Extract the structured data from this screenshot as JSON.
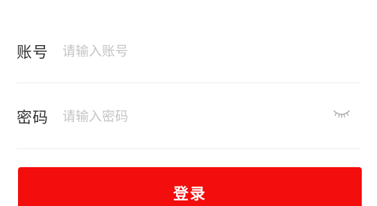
{
  "form": {
    "account": {
      "label": "账号",
      "placeholder": "请输入账号",
      "value": ""
    },
    "password": {
      "label": "密码",
      "placeholder": "请输入密码",
      "value": "",
      "visibility_icon": "eye-closed-icon"
    },
    "login_button": {
      "label": "登录"
    }
  },
  "colors": {
    "background": "#ffffff",
    "label_text": "#333333",
    "placeholder_text": "#c4c4c4",
    "divider": "#ececec",
    "primary_button": "#f40d0d",
    "button_text": "#ffffff",
    "icon": "#b0b0b0"
  }
}
